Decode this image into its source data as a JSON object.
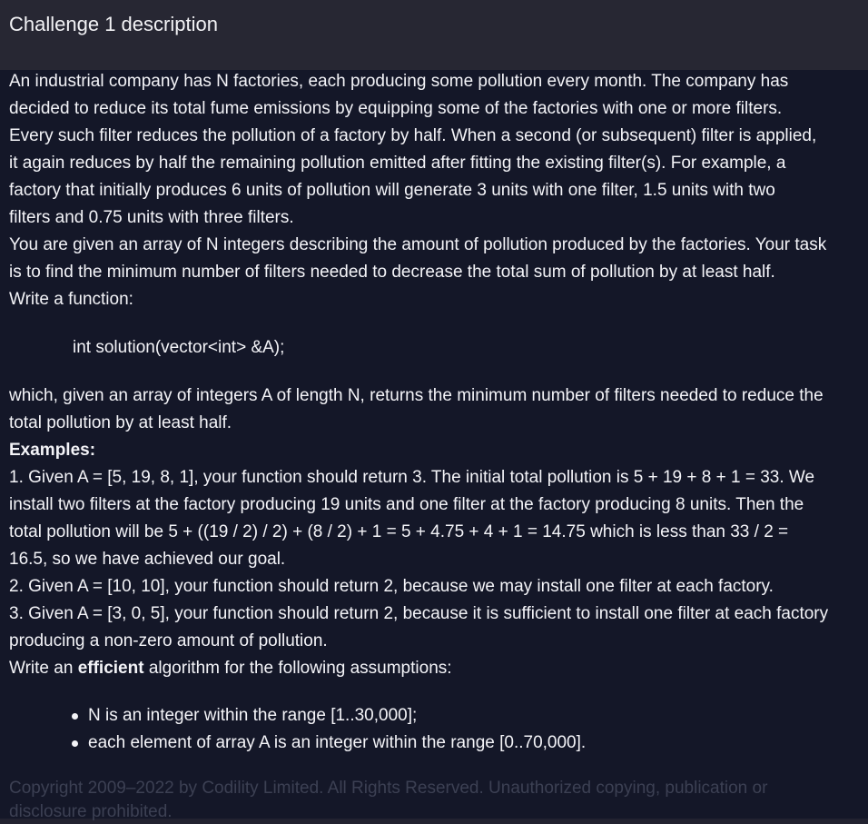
{
  "header": {
    "title": "Challenge 1 description"
  },
  "description": {
    "intro_lines": [
      "An industrial company has N factories, each producing some pollution every month. The company has",
      "decided to reduce its total fume emissions by equipping some of the factories with one or more filters.",
      "Every such filter reduces the pollution of a factory by half. When a second (or subsequent) filter is applied,",
      "it again reduces by half the remaining pollution emitted after fitting the existing filter(s). For example, a",
      "factory that initially produces 6 units of pollution will generate 3 units with one filter, 1.5 units with two",
      "filters and 0.75 units with three filters.",
      "You are given an array of N integers describing the amount of pollution produced by the factories. Your task",
      "is to find the minimum number of filters needed to decrease the total sum of pollution by at least half.",
      "Write a function:"
    ],
    "code_signature": "int solution(vector<int> &A);",
    "after_code_lines": [
      "which, given an array of integers A of length N, returns the minimum number of filters needed to reduce the",
      "total pollution by at least half."
    ],
    "examples_heading": "Examples:",
    "example_lines": [
      "1. Given A = [5, 19, 8, 1], your function should return 3. The initial total pollution is 5 + 19 + 8 + 1 = 33. We",
      "install two filters at the factory producing 19 units and one filter at the factory producing 8 units. Then the",
      "total pollution will be 5 + ((19 / 2) / 2) + (8 / 2) + 1 = 5 + 4.75 + 4 + 1 = 14.75 which is less than 33 / 2 =",
      "16.5, so we have achieved our goal.",
      "2. Given A = [10, 10], your function should return 2, because we may install one filter at each factory.",
      "3. Given A = [3, 0, 5], your function should return 2, because it is sufficient to install one filter at each factory",
      "producing a non-zero amount of pollution."
    ],
    "efficiency_prefix": "Write an ",
    "efficiency_bold": "efficient",
    "efficiency_suffix": " algorithm for the following assumptions:",
    "assumptions": [
      "N is an integer within the range [1..30,000];",
      "each element of array A is an integer within the range [0..70,000]."
    ],
    "copyright": "Copyright 2009–2022 by Codility Limited. All Rights Reserved. Unauthorized copying, publication or disclosure prohibited."
  }
}
